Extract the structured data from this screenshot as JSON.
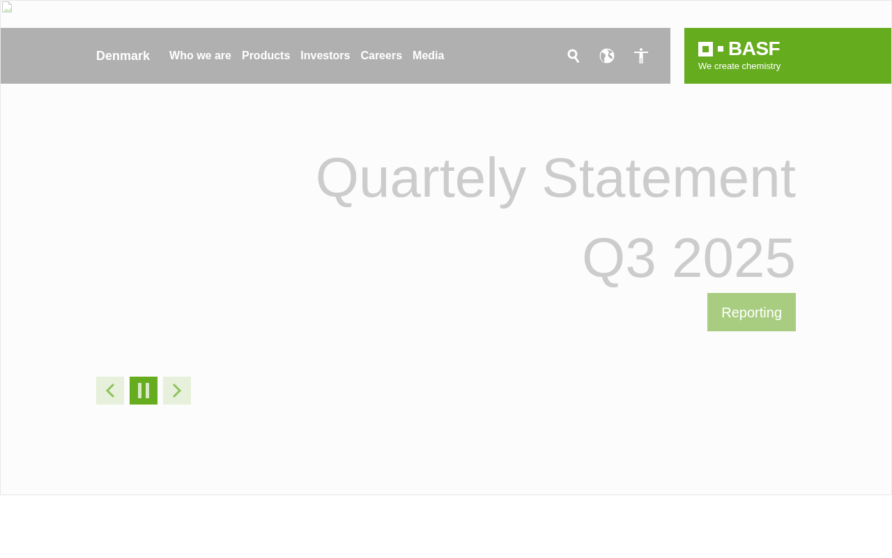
{
  "header": {
    "country": "Denmark",
    "nav_items": [
      {
        "label": "Who we are"
      },
      {
        "label": "Products"
      },
      {
        "label": "Investors"
      },
      {
        "label": "Careers"
      },
      {
        "label": "Media"
      }
    ]
  },
  "logo": {
    "wordmark": "BASF",
    "tagline": "We create chemistry"
  },
  "hero": {
    "title_lines": [
      "Quartely Statement",
      "Q3 2025"
    ],
    "button": "Reporting"
  },
  "carousel": {
    "controls": [
      {
        "kind": "prev"
      },
      {
        "kind": "pause"
      },
      {
        "kind": "next"
      }
    ]
  }
}
